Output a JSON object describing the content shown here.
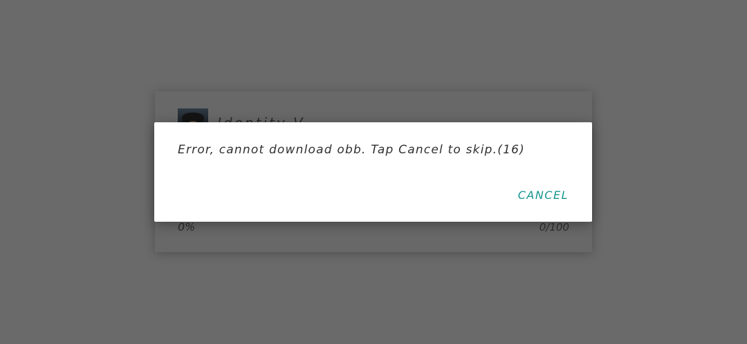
{
  "progress_dialog": {
    "title": "Identity V",
    "percent": "0%",
    "count": "0/100",
    "progress": 0
  },
  "alert": {
    "message": "Error, cannot download obb. Tap Cancel to skip.(16)",
    "cancel_label": "CANCEL"
  },
  "colors": {
    "scrim": "#6a6a6a",
    "dialog_bg": "#ffffff",
    "accent": "#16958f"
  }
}
